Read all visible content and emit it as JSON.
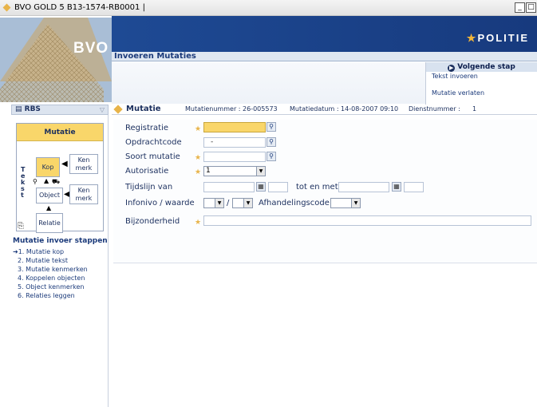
{
  "window": {
    "title": "BVO GOLD 5 B13-1574-RB0001 |",
    "buttons": [
      "_",
      "□"
    ]
  },
  "header": {
    "logo_text": "BVO",
    "brand": "POLITIE",
    "section_title": "Invoeren Mutaties",
    "next_step": "Volgende stap",
    "links": [
      "Tekst invoeren",
      "Mutatie verlaten"
    ]
  },
  "sidebar": {
    "panel_title": "RBS",
    "diagram": {
      "title": "Mutatie",
      "side_label": [
        "T",
        "e",
        "k",
        "s",
        "t"
      ],
      "kop": "Kop",
      "kenmerk_top": "Ken merk",
      "object": "Object",
      "kenmerk_bottom": "Ken merk",
      "relatie": "Relatie"
    },
    "steps_title": "Mutatie invoer stappen",
    "steps": [
      "➜1. Mutatie kop",
      "2. Mutatie tekst",
      "3. Mutatie kenmerken",
      "4. Koppelen objecten",
      "5. Object kenmerken",
      "6. Relaties leggen"
    ]
  },
  "form": {
    "title": "Mutatie",
    "mutatienummer": "Mutatienummer : 26-005573",
    "mutatiedatum": "Mutatiedatum : 14-08-2007 09:10",
    "dienstnummer": "Dienstnummer :",
    "dienstnummer_value": "1",
    "fields": {
      "registratie": "Registratie",
      "opdrachtcode": "Opdrachtcode",
      "opdrachtcode_value": "-",
      "soort_mutatie": "Soort mutatie",
      "autorisatie": "Autorisatie",
      "autorisatie_value": "1",
      "tijdslijn_van": "Tijdslijn van",
      "tot_en_met": "tot en met",
      "infonivo": "Infonivo / waarde",
      "slash": "/",
      "afhandelingscode": "Afhandelingscode",
      "bijzonderheid": "Bijzonderheid"
    },
    "required_mark": "★"
  }
}
